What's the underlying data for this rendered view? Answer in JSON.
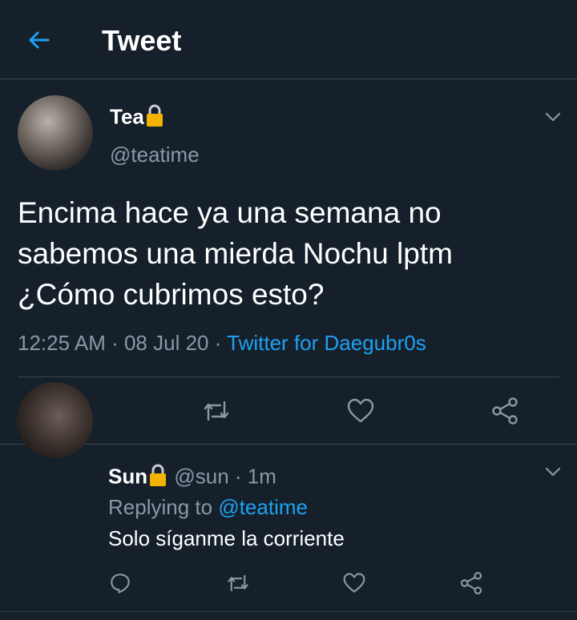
{
  "header": {
    "title": "Tweet"
  },
  "tweet": {
    "name": "Tea",
    "handle": "@teatime",
    "text_line1": "Encima hace ya una semana no",
    "text_line2": "sabemos una mierda Nochu lptm",
    "text_line3": "¿Cómo cubrimos esto?",
    "time": "12:25 AM",
    "date": "08 Jul 20",
    "client": "Twitter for Daegubr0s",
    "separator": " · "
  },
  "reply": {
    "name": "Sun",
    "handle": "@sun",
    "time": "1m",
    "separator": " · ",
    "replying_label": "Replying to ",
    "replying_to": "@teatime",
    "text": "Solo síganme la corriente"
  },
  "icons": {
    "back": "arrow-left-icon",
    "lock": "lock-icon",
    "chevron": "chevron-down-icon",
    "reply": "comment-icon",
    "retweet": "retweet-icon",
    "like": "heart-icon",
    "share": "share-icon"
  },
  "colors": {
    "background": "#15202b",
    "accent": "#1da1f2",
    "secondary_text": "#8899a6",
    "divider": "#38444d",
    "lock": "#f5b301"
  }
}
